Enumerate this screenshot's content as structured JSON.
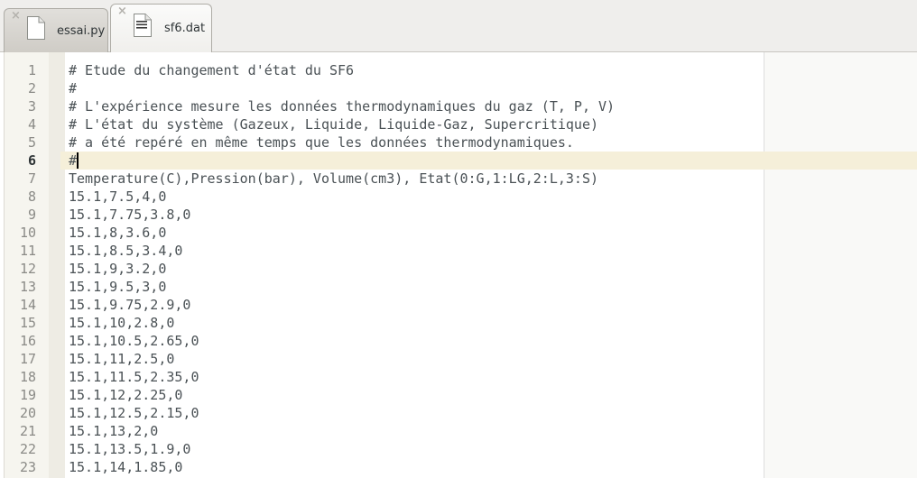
{
  "tabs": [
    {
      "label": "essai.py",
      "close_icon": "×",
      "icon": "text-file-icon",
      "active": false
    },
    {
      "label": "sf6.dat",
      "close_icon": "×",
      "icon": "text-document-icon",
      "active": true
    }
  ],
  "editor": {
    "current_line": 6,
    "lines": [
      {
        "number": "1",
        "text": "# Etude du changement d'état du SF6"
      },
      {
        "number": "2",
        "text": "#"
      },
      {
        "number": "3",
        "text": "# L'expérience mesure les données thermodynamiques du gaz (T, P, V)"
      },
      {
        "number": "4",
        "text": "# L'état du système (Gazeux, Liquide, Liquide-Gaz, Supercritique)"
      },
      {
        "number": "5",
        "text": "# a été repéré en même temps que les données thermodynamiques."
      },
      {
        "number": "6",
        "text": "#"
      },
      {
        "number": "7",
        "text": "Temperature(C),Pression(bar), Volume(cm3), Etat(0:G,1:LG,2:L,3:S)"
      },
      {
        "number": "8",
        "text": "15.1,7.5,4,0"
      },
      {
        "number": "9",
        "text": "15.1,7.75,3.8,0"
      },
      {
        "number": "10",
        "text": "15.1,8,3.6,0"
      },
      {
        "number": "11",
        "text": "15.1,8.5,3.4,0"
      },
      {
        "number": "12",
        "text": "15.1,9,3.2,0"
      },
      {
        "number": "13",
        "text": "15.1,9.5,3,0"
      },
      {
        "number": "14",
        "text": "15.1,9.75,2.9,0"
      },
      {
        "number": "15",
        "text": "15.1,10,2.8,0"
      },
      {
        "number": "16",
        "text": "15.1,10.5,2.65,0"
      },
      {
        "number": "17",
        "text": "15.1,11,2.5,0"
      },
      {
        "number": "18",
        "text": "15.1,11.5,2.35,0"
      },
      {
        "number": "19",
        "text": "15.1,12,2.25,0"
      },
      {
        "number": "20",
        "text": "15.1,12.5,2.15,0"
      },
      {
        "number": "21",
        "text": "15.1,13,2,0"
      },
      {
        "number": "22",
        "text": "15.1,13.5,1.9,0"
      },
      {
        "number": "23",
        "text": "15.1,14,1.85,0"
      }
    ]
  }
}
